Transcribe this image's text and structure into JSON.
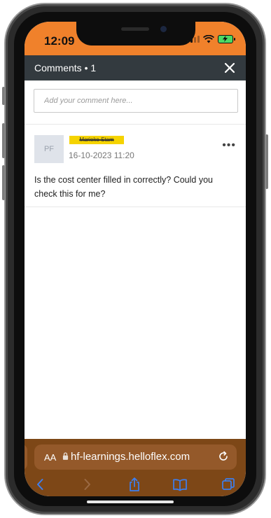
{
  "status_bar": {
    "time": "12:09"
  },
  "header": {
    "title": "Comments • 1"
  },
  "comment_form": {
    "placeholder": "Add your comment here..."
  },
  "comments": [
    {
      "avatar_initials": "PF",
      "author": "Marieke Stam",
      "timestamp": "16-10-2023 11:20",
      "text": "Is the cost center filled in correctly? Could you check this for me?"
    }
  ],
  "browser": {
    "text_size_label": "AA",
    "url": "hf-learnings.helloflex.com"
  },
  "icons": {
    "close": "close-icon",
    "more": "more-options-icon",
    "lock": "lock-icon",
    "reload": "reload-icon",
    "back": "back-arrow-icon",
    "forward": "forward-arrow-icon",
    "share": "share-icon",
    "bookmarks": "bookmarks-icon",
    "tabs": "tabs-icon"
  },
  "colors": {
    "status_bar": "#f0812b",
    "header": "#333a3f",
    "browser_bar": "#7d4717",
    "author_highlight": "#f5d300"
  }
}
